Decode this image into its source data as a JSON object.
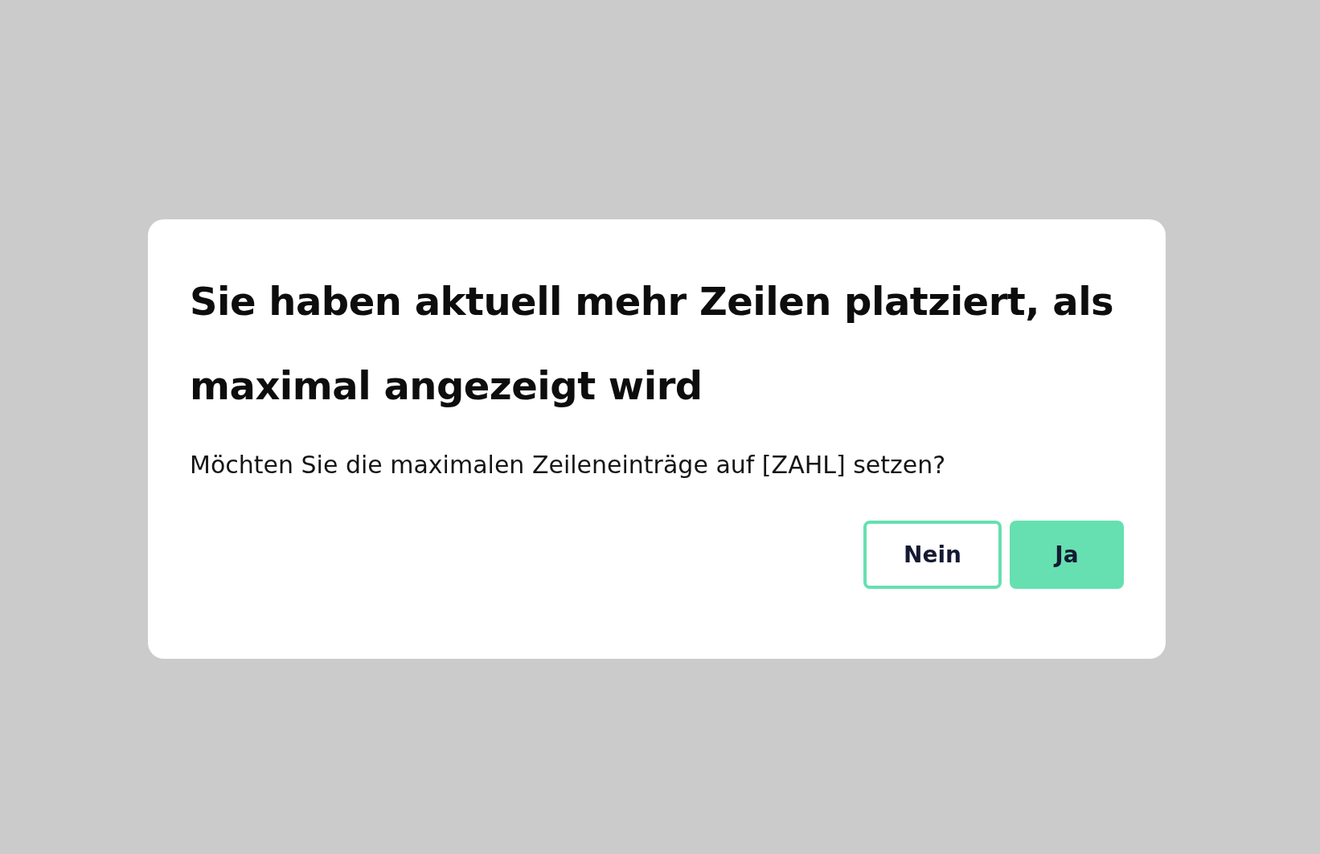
{
  "dialog": {
    "title": "Sie haben aktuell mehr Zeilen platziert, als maximal angezeigt wird",
    "message": "Möchten Sie die maximalen Zeileneinträge auf [ZAHL] setzen?",
    "buttons": [
      {
        "label": "Nein",
        "kind": "secondary"
      },
      {
        "label": "Ja",
        "kind": "primary"
      }
    ]
  }
}
